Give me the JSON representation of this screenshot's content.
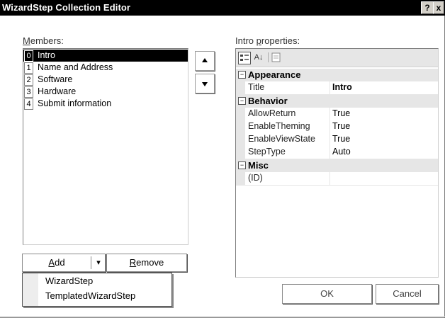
{
  "window": {
    "title": "WizardStep Collection Editor",
    "help_button": "?",
    "close_button": "x"
  },
  "members": {
    "label_accel": "M",
    "label_rest": "embers:",
    "items": [
      {
        "index": "0",
        "label": "Intro",
        "selected": true
      },
      {
        "index": "1",
        "label": "Name and Address",
        "selected": false
      },
      {
        "index": "2",
        "label": "Software",
        "selected": false
      },
      {
        "index": "3",
        "label": "Hardware",
        "selected": false
      },
      {
        "index": "4",
        "label": "Submit information",
        "selected": false
      }
    ]
  },
  "reorder": {
    "up_icon": "up-arrow-icon",
    "down_icon": "down-arrow-icon"
  },
  "properties": {
    "label_pre": "Intro ",
    "label_accel": "p",
    "label_rest": "roperties:",
    "toolbar": {
      "categorized_icon": "categorized-icon",
      "alphabetical_glyph": "A↓",
      "alphabetical_icon": "sort-alphabetical-icon",
      "pages_icon": "property-pages-icon"
    },
    "categories": [
      {
        "name": "Appearance",
        "expand_glyph": "⊟",
        "rows": [
          {
            "name": "Title",
            "value": "Intro",
            "bold": true
          }
        ]
      },
      {
        "name": "Behavior",
        "expand_glyph": "⊟",
        "rows": [
          {
            "name": "AllowReturn",
            "value": "True"
          },
          {
            "name": "EnableTheming",
            "value": "True"
          },
          {
            "name": "EnableViewState",
            "value": "True"
          },
          {
            "name": "StepType",
            "value": "Auto"
          }
        ]
      },
      {
        "name": "Misc",
        "expand_glyph": "⊟",
        "rows": [
          {
            "name": "(ID)",
            "value": ""
          }
        ]
      }
    ]
  },
  "buttons": {
    "add_accel": "A",
    "add_rest": "dd",
    "add_arrow": "▾",
    "remove_accel": "R",
    "remove_rest": "emove",
    "ok": "OK",
    "cancel": "Cancel"
  },
  "add_menu": {
    "items": [
      "WizardStep",
      "TemplatedWizardStep"
    ]
  }
}
